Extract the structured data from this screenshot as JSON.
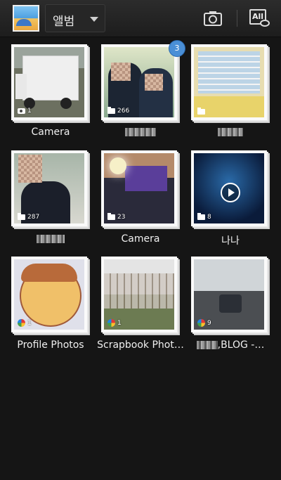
{
  "header": {
    "album_selector": "앨범",
    "camera_icon": "camera-icon",
    "view_all_icon": "view-all-icon",
    "view_all_text": "All"
  },
  "albums": [
    {
      "label": "Camera",
      "count": "1",
      "icon": "camera-icon"
    },
    {
      "label": "",
      "count": "266",
      "icon": "folder-icon",
      "badge": "3",
      "label_obscured": true
    },
    {
      "label": "",
      "count": "",
      "icon": "folder-icon",
      "label_obscured": true
    },
    {
      "label": "",
      "count": "287",
      "icon": "folder-icon",
      "label_obscured": true
    },
    {
      "label": "Camera",
      "count": "23",
      "icon": "folder-icon"
    },
    {
      "label": "나나",
      "count": "8",
      "icon": "folder-icon"
    },
    {
      "label": "Profile Photos",
      "count": "1",
      "icon": "picasa-icon"
    },
    {
      "label": "Scrapbook Phot…",
      "count": "1",
      "icon": "picasa-icon"
    },
    {
      "label": ",BLOG -…",
      "count": "9",
      "icon": "picasa-icon",
      "label_obscured": true
    }
  ],
  "colors": {
    "background": "#151515",
    "badge": "#4a8fd6",
    "label": "#f0f0f0"
  }
}
